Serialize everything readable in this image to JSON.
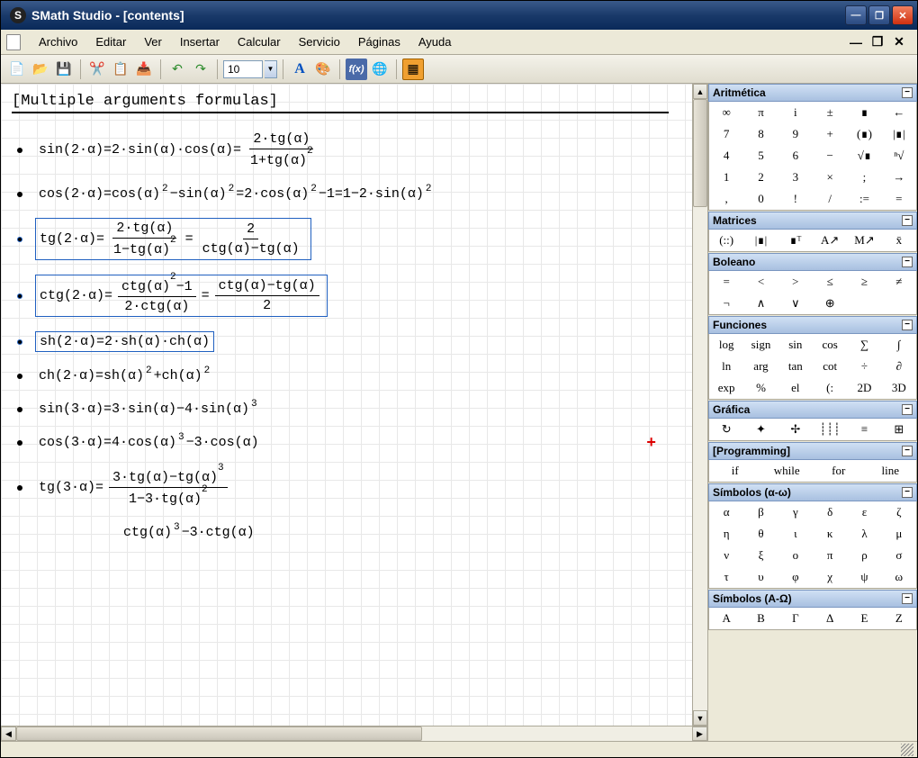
{
  "window": {
    "title": "SMath Studio - [contents]"
  },
  "menu": {
    "items": [
      "Archivo",
      "Editar",
      "Ver",
      "Insertar",
      "Calcular",
      "Servicio",
      "Páginas",
      "Ayuda"
    ]
  },
  "toolbar": {
    "font_size": "10"
  },
  "document": {
    "title": "[Multiple arguments formulas]",
    "formulas": [
      "sin(2·α)=2·sin(α)·cos(α)= (2·tg(α)) / (1+tg(α)²)",
      "cos(2·α)=cos(α)² − sin(α)² = 2·cos(α)² − 1 = 1 − 2·sin(α)²",
      "tg(2·α)= (2·tg(α)) / (1−tg(α)²) = 2 / (ctg(α)−tg(α))",
      "ctg(2·α)= (ctg(α)²−1) / (2·ctg(α)) = (ctg(α)−tg(α)) / 2",
      "sh(2·α)=2·sh(α)·ch(α)",
      "ch(2·α)=sh(α)² + ch(α)²",
      "sin(3·α)=3·sin(α) − 4·sin(α)³",
      "cos(3·α)=4·cos(α)³ − 3·cos(α)",
      "tg(3·α)= (3·tg(α)−tg(α)³) / (1−3·tg(α)²)",
      "ctg(α)³ − 3·ctg(α)"
    ]
  },
  "palettes": {
    "arithmetic": {
      "title": "Aritmética",
      "cells": [
        "∞",
        "π",
        "i",
        "±",
        "∎",
        "←",
        "7",
        "8",
        "9",
        "+",
        "(∎)",
        "|∎|",
        "4",
        "5",
        "6",
        "−",
        "√∎",
        "ⁿ√",
        "1",
        "2",
        "3",
        "×",
        ";",
        "→",
        ",",
        "0",
        "!",
        "/",
        ":=",
        "="
      ]
    },
    "matrices": {
      "title": "Matrices",
      "cells": [
        "(::)",
        "|∎|",
        "∎ᵀ",
        "A↗",
        "M↗",
        "x̄"
      ]
    },
    "boolean": {
      "title": "Boleano",
      "cells": [
        "=",
        "<",
        ">",
        "≤",
        "≥",
        "≠",
        "¬",
        "∧",
        "∨",
        "⊕",
        "",
        ""
      ]
    },
    "functions": {
      "title": "Funciones",
      "cells": [
        "log",
        "sign",
        "sin",
        "cos",
        "∑",
        "∫",
        "ln",
        "arg",
        "tan",
        "cot",
        "÷",
        "∂",
        "exp",
        "%",
        "el",
        "(:",
        "2D",
        "3D"
      ]
    },
    "graphic": {
      "title": "Gráfica",
      "cells": [
        "↻",
        "✦",
        "✢",
        "┊┊┊",
        "≡",
        "⊞"
      ]
    },
    "programming": {
      "title": "[Programming]",
      "cells": [
        "if",
        "while",
        "for",
        "line"
      ]
    },
    "symbols_lower": {
      "title": "Símbolos (α-ω)",
      "cells": [
        "α",
        "β",
        "γ",
        "δ",
        "ε",
        "ζ",
        "η",
        "θ",
        "ι",
        "κ",
        "λ",
        "μ",
        "ν",
        "ξ",
        "ο",
        "π",
        "ρ",
        "σ",
        "τ",
        "υ",
        "φ",
        "χ",
        "ψ",
        "ω"
      ]
    },
    "symbols_upper": {
      "title": "Símbolos (A-Ω)",
      "cells": [
        "Α",
        "Β",
        "Γ",
        "Δ",
        "Ε",
        "Ζ"
      ]
    }
  }
}
